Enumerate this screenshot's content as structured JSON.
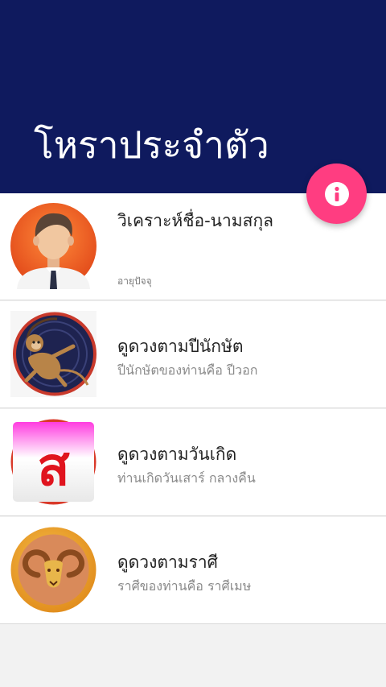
{
  "header": {
    "title": "โหราประจำตัว"
  },
  "fab": {
    "icon": "info-icon"
  },
  "colors": {
    "header_bg": "#0f1a5e",
    "fab_bg": "#ff3d81"
  },
  "items": [
    {
      "title": "วิเคราะห์ชื่อ-นามสกุล",
      "subtitle": "อายุปัจจุ",
      "icon": "businessman-avatar-icon"
    },
    {
      "title": "ดูดวงตามปีนักษัต",
      "subtitle": "ปีนักษัตของท่านคือ ปีวอก",
      "icon": "monkey-zodiac-icon"
    },
    {
      "title": "ดูดวงตามวันเกิด",
      "subtitle": "ท่านเกิดวันเสาร์ กลางคืน",
      "icon": "thai-letter-sor-icon",
      "icon_text": "ส"
    },
    {
      "title": "ดูดวงตามราศี",
      "subtitle": "ราศีของท่านคือ ราศีเมษ",
      "icon": "aries-ram-icon"
    }
  ]
}
